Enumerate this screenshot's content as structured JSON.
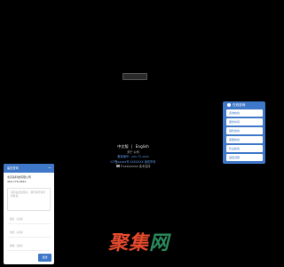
{
  "center": {
    "chip_label": ""
  },
  "footer": {
    "lang_cn": "中文版",
    "lang_sep": "|",
    "lang_en": "English",
    "line1": "关于 公司",
    "line2": "备案编号：xxx-72-xxxx",
    "line3": "ICP备xxxxx号 XXXXXXX 版权所有",
    "line4": "©xxxxxxxxx 技术支持"
  },
  "contact_widget": {
    "title": "在线咨询",
    "items": [
      "咨询热线",
      "服务时间",
      "销售热线",
      "客服热线",
      "售后热线",
      "返回顶部"
    ]
  },
  "chat_panel": {
    "title": "留言咨询",
    "minimize": "—",
    "company": "北京某科技有限公司",
    "phone": "400-779-0950",
    "message_placeholder": "请您在此处留言，我们将尽快与您联系。",
    "name_placeholder": "姓名（必填）",
    "phone_placeholder": "电话（必填）",
    "email_placeholder": "邮箱（选填）",
    "send_label": "发送"
  },
  "watermark": {
    "text_red": "聚集",
    "text_green": "网"
  }
}
